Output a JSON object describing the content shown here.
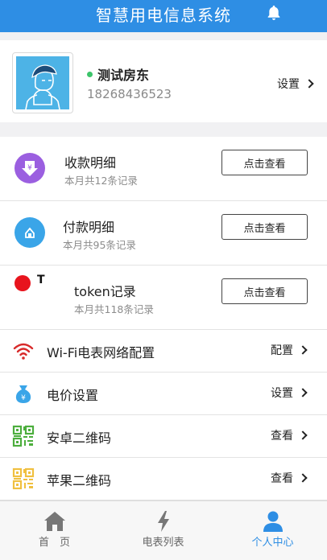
{
  "header": {
    "title": "智慧用电信息系统",
    "bell_icon": "bell-icon"
  },
  "profile": {
    "name": "测试房东",
    "phone": "18268436523",
    "settings_label": "设置",
    "status_color": "#3cc46a"
  },
  "records": [
    {
      "title": "收款明细",
      "subtitle": "本月共12条记录",
      "button": "点击查看",
      "icon": "income-icon",
      "icon_color": "#9b5fe0"
    },
    {
      "title": "付款明细",
      "subtitle": "本月共95条记录",
      "button": "点击查看",
      "icon": "payment-icon",
      "icon_color": "#3aa5e8"
    },
    {
      "title": "token记录",
      "subtitle": "本月共118条记录",
      "button": "点击查看",
      "icon": "token-icon",
      "icon_color": "#e8141d"
    }
  ],
  "menu": [
    {
      "label": "Wi-Fi电表网络配置",
      "action": "配置",
      "icon": "wifi-icon"
    },
    {
      "label": "电价设置",
      "action": "设置",
      "icon": "money-bag-icon"
    },
    {
      "label": "安卓二维码",
      "action": "查看",
      "icon": "qr-code-icon"
    },
    {
      "label": "苹果二维码",
      "action": "查看",
      "icon": "qr-code-icon"
    }
  ],
  "tabbar": {
    "tabs": [
      {
        "label": "首　页",
        "icon": "home-icon"
      },
      {
        "label": "电表列表",
        "icon": "lightning-icon"
      },
      {
        "label": "个人中心",
        "icon": "person-icon"
      }
    ],
    "active": "个人中心",
    "active_color": "#2e8ee4"
  },
  "colors": {
    "primary": "#2e8ee4",
    "qr_android": "#4cae3d",
    "qr_apple": "#f0c040"
  }
}
